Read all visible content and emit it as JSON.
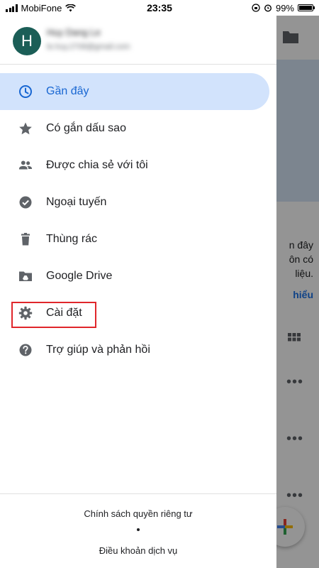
{
  "status_bar": {
    "carrier": "MobiFone",
    "time": "23:35",
    "battery": "99%",
    "battery_level": 0.99
  },
  "account": {
    "avatar_letter": "H",
    "name": "Huy Dang Le",
    "email": "le.huy.2708@gmail.com"
  },
  "nav": [
    {
      "label": "Gần đây",
      "icon": "clock-icon",
      "active": true
    },
    {
      "label": "Có gắn dấu sao",
      "icon": "star-icon"
    },
    {
      "label": "Được chia sẻ với tôi",
      "icon": "people-icon"
    },
    {
      "label": "Ngoại tuyến",
      "icon": "offline-check-icon"
    },
    {
      "label": "Thùng rác",
      "icon": "trash-icon"
    },
    {
      "label": "Google Drive",
      "icon": "drive-folder-icon"
    },
    {
      "label": "Cài đặt",
      "icon": "gear-icon"
    },
    {
      "label": "Trợ giúp và phản hồi",
      "icon": "help-icon"
    }
  ],
  "footer": {
    "privacy": "Chính sách quyền riêng tư",
    "terms": "Điều khoản dịch vụ"
  },
  "background": {
    "text_line1": "n đây",
    "text_line2": "ôn có",
    "text_line3": "liệu.",
    "link": "hiểu"
  },
  "colors": {
    "accent": "#1967d2",
    "active_bg": "#d2e3fc",
    "avatar_bg": "#1b5e57",
    "highlight": "#e0262b"
  }
}
